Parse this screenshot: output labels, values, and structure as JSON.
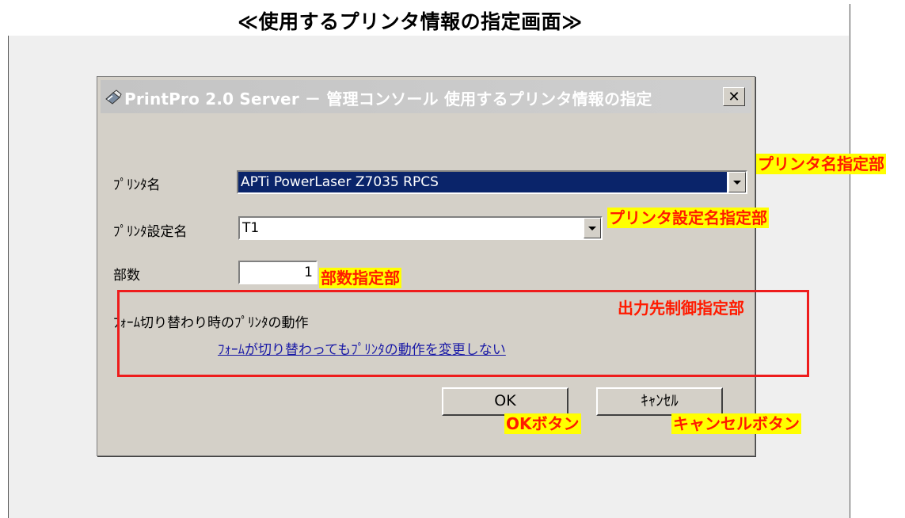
{
  "page": {
    "title": "≪使用するプリンタ情報の指定画面≫"
  },
  "dialog": {
    "title": "PrintPro 2.0 Server － 管理コンソール 使用するプリンタ情報の指定",
    "close_label": "✕",
    "printer_label": "ﾌﾟﾘﾝﾀ名",
    "printer_value": "APTi PowerLaser Z7035 RPCS",
    "printer_setting_label": "ﾌﾟﾘﾝﾀ設定名",
    "printer_setting_value": "T1",
    "copies_label": "部数",
    "copies_value": "1",
    "behavior_label": "ﾌｫｰﾑ切り替わり時のﾌﾟﾘﾝﾀの動作",
    "behavior_link": "ﾌｫｰﾑが切り替わってもﾌﾟﾘﾝﾀの動作を変更しない",
    "ok_label": "OK",
    "cancel_label": "ｷｬﾝｾﾙ"
  },
  "annotations": {
    "printer_name": "プリンタ名指定部",
    "printer_setting": "プリンタ設定名指定部",
    "copies": "部数指定部",
    "output_control": "出力先制御指定部",
    "ok_button": "OKボタン",
    "cancel_button": "キャンセルボタン"
  },
  "colors": {
    "highlight_box": "#ee1c1c",
    "callout_bg": "#ffff00",
    "callout_text": "#ff1a00",
    "selection": "#0a246a",
    "link": "#1a1aa6",
    "dialog_face": "#d4d0c8"
  }
}
